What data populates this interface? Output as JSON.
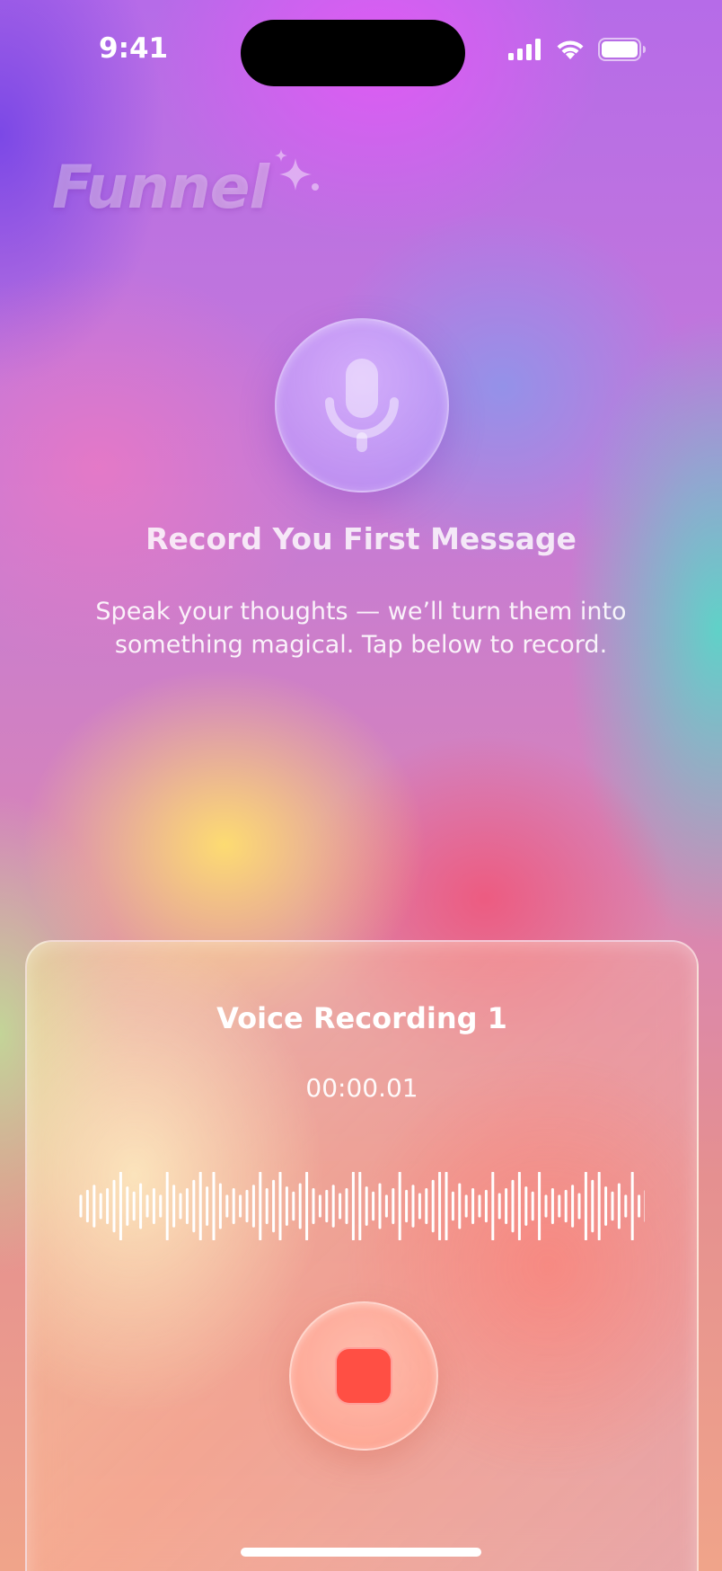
{
  "status_bar": {
    "time": "9:41",
    "icons": [
      "cellular-signal-icon",
      "wifi-icon",
      "battery-icon"
    ]
  },
  "logo": {
    "text": "Funnel",
    "icon": "sparkle-icon"
  },
  "hero": {
    "icon": "microphone-icon",
    "title": "Record You First Message",
    "subtitle_line1": "Speak your thoughts — we’ll turn them into",
    "subtitle_line2": "something magical. Tap below to record."
  },
  "recording_card": {
    "title": "Voice Recording 1",
    "elapsed": "00:00.01",
    "waveform_icon": "audio-waveform",
    "stop_icon": "stop-icon"
  },
  "colors": {
    "stop_red": "#ff4f44",
    "text": "#ffffff"
  }
}
